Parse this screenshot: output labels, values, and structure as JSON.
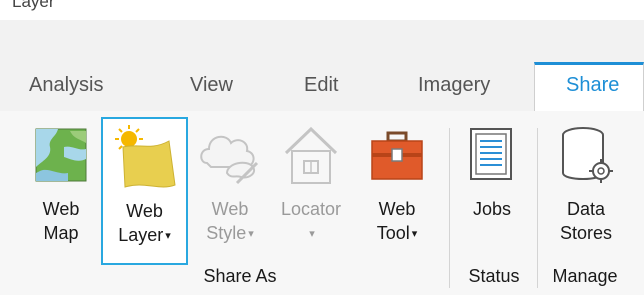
{
  "page": {
    "top_fragment": "Layer"
  },
  "tabs": [
    {
      "label": "Analysis",
      "active": false
    },
    {
      "label": "View",
      "active": false
    },
    {
      "label": "Edit",
      "active": false
    },
    {
      "label": "Imagery",
      "active": false
    },
    {
      "label": "Share",
      "active": true
    }
  ],
  "ribbon": {
    "buttons": [
      {
        "line1": "Web",
        "line2": "Map",
        "icon": "web-map-icon",
        "enabled": true,
        "dropdown": false
      },
      {
        "line1": "Web",
        "line2": "Layer",
        "icon": "web-layer-icon",
        "enabled": true,
        "dropdown": true,
        "selected": true
      },
      {
        "line1": "Web",
        "line2": "Style",
        "icon": "web-style-icon",
        "enabled": false,
        "dropdown": true
      },
      {
        "line1": "Locator",
        "line2": "",
        "icon": "locator-icon",
        "enabled": false,
        "dropdown": true
      },
      {
        "line1": "Web",
        "line2": "Tool",
        "icon": "web-tool-icon",
        "enabled": true,
        "dropdown": true
      },
      {
        "line1": "Jobs",
        "line2": "",
        "icon": "jobs-icon",
        "enabled": true,
        "dropdown": false
      },
      {
        "line1": "Data",
        "line2": "Stores",
        "icon": "data-stores-icon",
        "enabled": true,
        "dropdown": false
      }
    ],
    "groups": [
      {
        "label": "Share As"
      },
      {
        "label": "Status"
      },
      {
        "label": "Manage"
      }
    ],
    "dropdown_glyph": "▾"
  },
  "colors": {
    "accent": "#1e8fd6",
    "selection_border": "#29a8e0",
    "disabled_text": "#9a9a9a"
  }
}
